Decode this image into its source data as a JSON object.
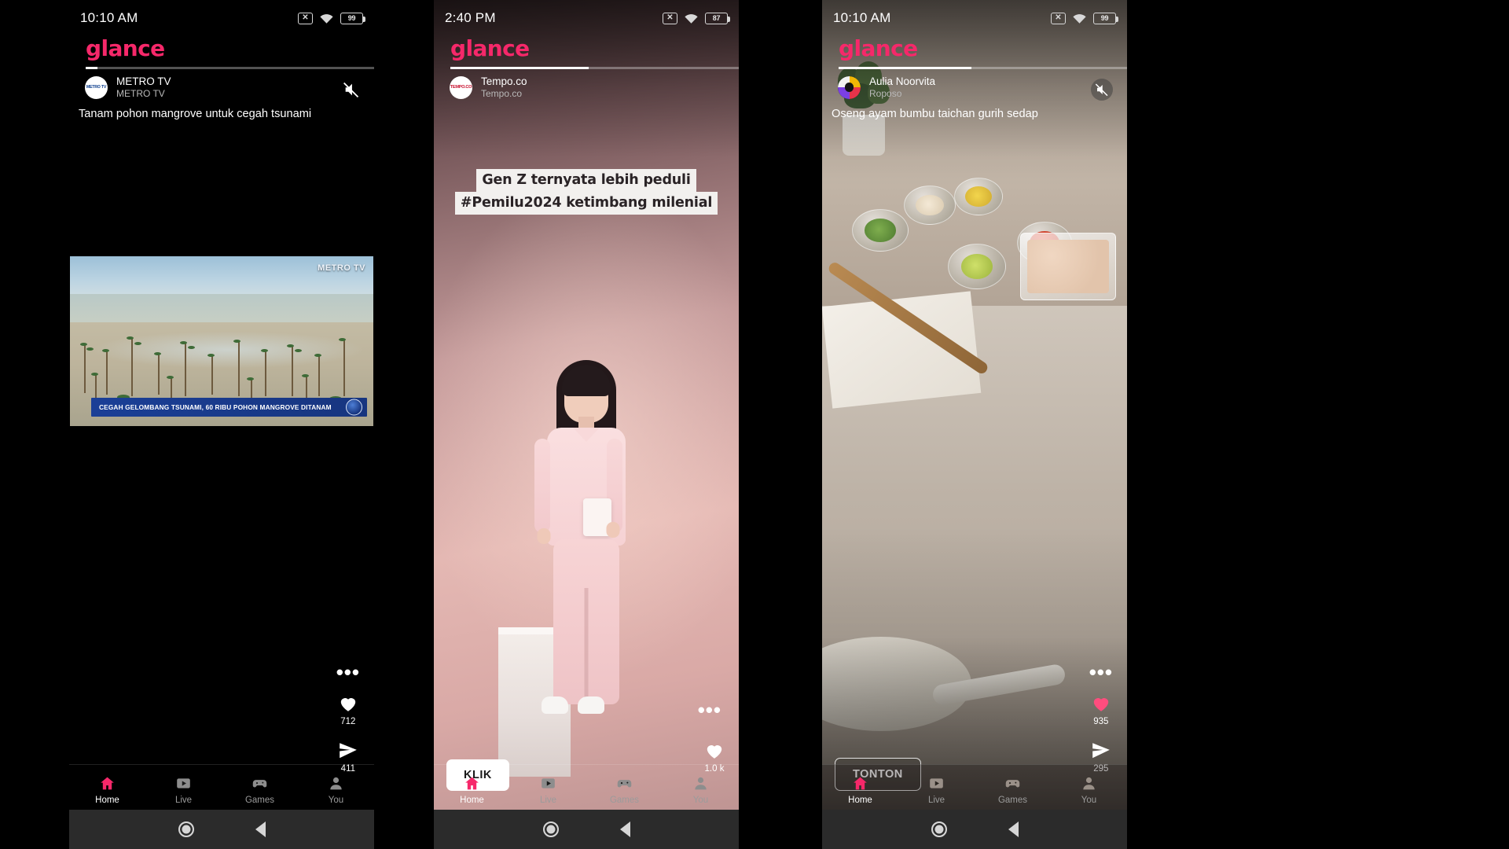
{
  "app": {
    "logo_text": "glance"
  },
  "panels": [
    {
      "id": "panel-1",
      "status": {
        "time": "10:10 AM",
        "battery": "99",
        "sim_icon": "sim-off-icon",
        "wifi_icon": "wifi-icon",
        "battery_icon": "battery-icon"
      },
      "progress_percent": 4,
      "author": {
        "name": "METRO TV",
        "subtitle": "METRO TV",
        "avatar_label": "METRO TV",
        "avatar_icon": "metro-tv-avatar"
      },
      "headline": "Tanam pohon mangrove untuk cegah tsunami",
      "mute": {
        "icon": "mute-icon",
        "state": "muted"
      },
      "more_label": "•••",
      "actions": [
        {
          "name": "like",
          "icon": "heart-icon",
          "count": "712",
          "filled": false
        },
        {
          "name": "share",
          "icon": "share-icon",
          "count": "411",
          "filled": false
        }
      ],
      "cta": null,
      "video": {
        "channel_watermark": "METRO TV",
        "ticker_text": "CEGAH GELOMBANG TSUNAMI, 60 RIBU POHON MANGROVE DITANAM"
      },
      "nav": [
        {
          "label": "Home",
          "icon": "home-icon",
          "active": true
        },
        {
          "label": "Live",
          "icon": "live-play-icon",
          "active": false
        },
        {
          "label": "Games",
          "icon": "gamepad-icon",
          "active": false
        },
        {
          "label": "You",
          "icon": "person-icon",
          "active": false
        }
      ],
      "sysnav": {
        "home_icon": "system-home-icon",
        "back_icon": "system-back-icon"
      }
    },
    {
      "id": "panel-2",
      "status": {
        "time": "2:40 PM",
        "battery": "87",
        "sim_icon": "sim-off-icon",
        "wifi_icon": "wifi-icon",
        "battery_icon": "battery-icon"
      },
      "progress_percent": 48,
      "author": {
        "name": "Tempo.co",
        "subtitle": "Tempo.co",
        "avatar_label": "TEMPO.CO",
        "avatar_icon": "tempo-avatar"
      },
      "headline": "",
      "mute": null,
      "more_label": "•••",
      "caption_lines": [
        "Gen Z ternyata lebih peduli",
        "#Pemilu2024 ketimbang milenial"
      ],
      "actions": [
        {
          "name": "like",
          "icon": "heart-icon",
          "count": "1.0 k",
          "filled": false
        }
      ],
      "cta": {
        "label": "KLIK",
        "style": "solid"
      },
      "nav": [
        {
          "label": "Home",
          "icon": "home-icon",
          "active": true
        },
        {
          "label": "Live",
          "icon": "live-play-icon",
          "active": false
        },
        {
          "label": "Games",
          "icon": "gamepad-icon",
          "active": false
        },
        {
          "label": "You",
          "icon": "person-icon",
          "active": false
        }
      ],
      "sysnav": {
        "home_icon": "system-home-icon",
        "back_icon": "system-back-icon"
      }
    },
    {
      "id": "panel-3",
      "status": {
        "time": "10:10 AM",
        "battery": "99",
        "sim_icon": "sim-off-icon",
        "wifi_icon": "wifi-icon",
        "battery_icon": "battery-icon"
      },
      "progress_percent": 46,
      "author": {
        "name": "Aulia Noorvita",
        "subtitle": "Roposo",
        "avatar_label": "",
        "avatar_icon": "roposo-avatar"
      },
      "headline": "Oseng ayam bumbu taichan gurih sedap",
      "mute": {
        "icon": "mute-icon",
        "state": "muted"
      },
      "more_label": "•••",
      "actions": [
        {
          "name": "like",
          "icon": "heart-icon",
          "count": "935",
          "filled": true
        },
        {
          "name": "share",
          "icon": "share-icon",
          "count": "295",
          "filled": false
        }
      ],
      "cta": {
        "label": "TONTON",
        "style": "outline"
      },
      "nav": [
        {
          "label": "Home",
          "icon": "home-icon",
          "active": true
        },
        {
          "label": "Live",
          "icon": "live-play-icon",
          "active": false
        },
        {
          "label": "Games",
          "icon": "gamepad-icon",
          "active": false
        },
        {
          "label": "You",
          "icon": "person-icon",
          "active": false
        }
      ],
      "sysnav": {
        "home_icon": "system-home-icon",
        "back_icon": "system-back-icon"
      }
    }
  ],
  "colors": {
    "brand_pink": "#f6286a",
    "active_nav": "#f6286a",
    "like_filled": "#ff4d7e",
    "inactive_nav": "#8d8d8d",
    "ticker_blue": "#1b3f97"
  }
}
